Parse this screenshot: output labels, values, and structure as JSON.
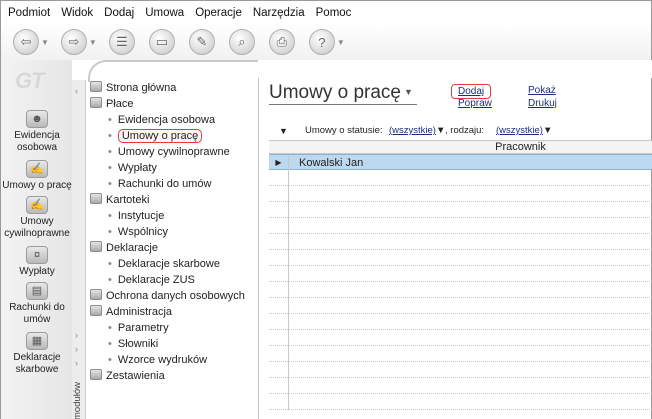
{
  "menu": [
    "Podmiot",
    "Widok",
    "Dodaj",
    "Umowa",
    "Operacje",
    "Narzędzia",
    "Pomoc"
  ],
  "toolbar": {
    "buttons": [
      "back-icon",
      "forward-icon",
      "module-icon",
      "document-icon",
      "edit-icon",
      "print-preview-icon",
      "print-icon",
      "help-icon"
    ]
  },
  "modules": [
    {
      "label": "Ewidencja osobowa",
      "icon": "people-icon"
    },
    {
      "label": "Umowy o pracę",
      "icon": "contract-icon"
    },
    {
      "label": "Umowy cywilnoprawne",
      "icon": "contract-civil-icon"
    },
    {
      "label": "Wypłaty",
      "icon": "payout-icon"
    },
    {
      "label": "Rachunki do umów",
      "icon": "bill-icon"
    },
    {
      "label": "Deklaracje skarbowe",
      "icon": "declaration-icon"
    }
  ],
  "tree": {
    "strip_label": "modułów",
    "items": [
      {
        "label": "Strona główna",
        "level": 0
      },
      {
        "label": "Płace",
        "level": 0
      },
      {
        "label": "Ewidencja osobowa",
        "level": 1
      },
      {
        "label": "Umowy o pracę",
        "level": 1,
        "selected": true
      },
      {
        "label": "Umowy cywilnoprawne",
        "level": 1
      },
      {
        "label": "Wypłaty",
        "level": 1
      },
      {
        "label": "Rachunki do umów",
        "level": 1
      },
      {
        "label": "Kartoteki",
        "level": 0
      },
      {
        "label": "Instytucje",
        "level": 1
      },
      {
        "label": "Wspólnicy",
        "level": 1
      },
      {
        "label": "Deklaracje",
        "level": 0
      },
      {
        "label": "Deklaracje skarbowe",
        "level": 1
      },
      {
        "label": "Deklaracje ZUS",
        "level": 1
      },
      {
        "label": "Ochrona danych osobowych",
        "level": 0
      },
      {
        "label": "Administracja",
        "level": 0
      },
      {
        "label": "Parametry",
        "level": 1
      },
      {
        "label": "Słowniki",
        "level": 1
      },
      {
        "label": "Wzorce wydruków",
        "level": 1
      },
      {
        "label": "Zestawienia",
        "level": 0
      }
    ]
  },
  "main": {
    "title": "Umowy o pracę",
    "actions": {
      "add": "Dodaj",
      "show": "Pokaż",
      "edit": "Popraw",
      "print": "Drukuj"
    },
    "filter": {
      "status_label": "Umowy o statusie:",
      "status_value": "(wszystkie)",
      "kind_label": ", rodzaju:",
      "kind_value": "(wszystkie)"
    },
    "column": "Pracownik",
    "rows": [
      "Kowalski Jan"
    ]
  },
  "colors": {
    "accent_highlight": "#e23c3c",
    "selected_row": "#bdd9ef",
    "link": "#1b2f74"
  }
}
